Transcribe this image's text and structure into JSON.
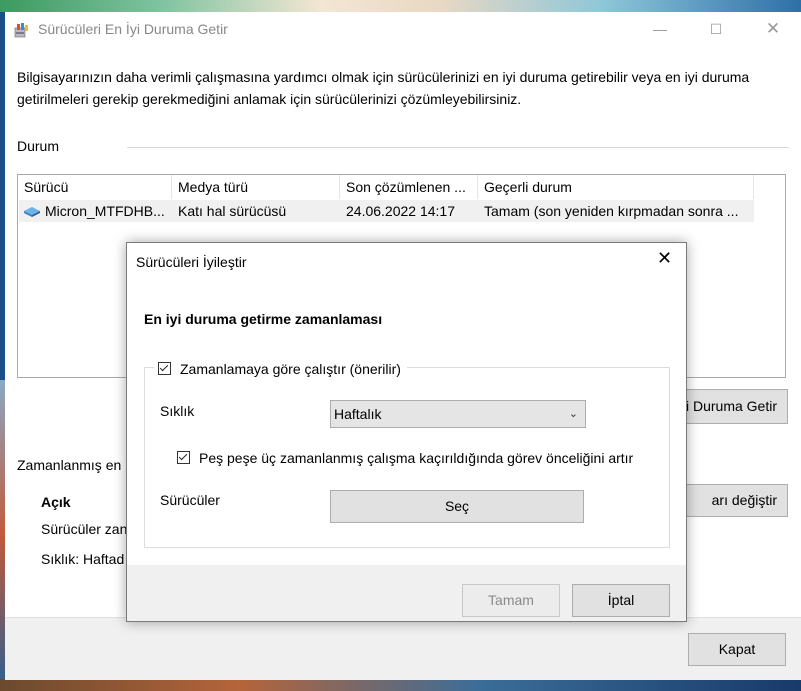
{
  "window": {
    "title": "Sürücüleri En İyi Duruma Getir",
    "controls": {
      "minimize": "—",
      "maximize": "☐",
      "close": "✕"
    }
  },
  "description": "Bilgisayarınızın daha verimli çalışmasına yardımcı olmak için sürücülerinizi en iyi duruma getirebilir veya en iyi duruma getirilmeleri gerekip gerekmediğini anlamak için sürücülerinizi çözümleyebilirsiniz.",
  "status_section": {
    "label": "Durum",
    "columns": [
      "Sürücü",
      "Medya türü",
      "Son çözümlenen ...",
      "Geçerli durum"
    ],
    "rows": [
      {
        "drive": "Micron_MTFDHB...",
        "media": "Katı hal sürücüsü",
        "last": "24.06.2022 14:17",
        "status": "Tamam (son yeniden kırpmadan sonra ..."
      }
    ]
  },
  "optimize_button": "i Duruma Getir",
  "scheduled": {
    "label": "Zamanlanmış en",
    "state": "Açık",
    "line1": "Sürücüler zan",
    "line2": "Sıklık: Haftad",
    "change_button": "arı değiştir"
  },
  "close_button": "Kapat",
  "dialog": {
    "title": "Sürücüleri İyileştir",
    "close": "✕",
    "heading": "En iyi duruma getirme zamanlaması",
    "run_on_schedule": "Zamanlamaya göre çalıştır (önerilir)",
    "frequency_label": "Sıklık",
    "frequency_value": "Haftalık",
    "increase_priority": "Peş peşe üç zamanlanmış çalışma kaçırıldığında görev önceliğini artır",
    "drives_label": "Sürücüler",
    "select_button": "Seç",
    "ok_button": "Tamam",
    "cancel_button": "İptal"
  }
}
